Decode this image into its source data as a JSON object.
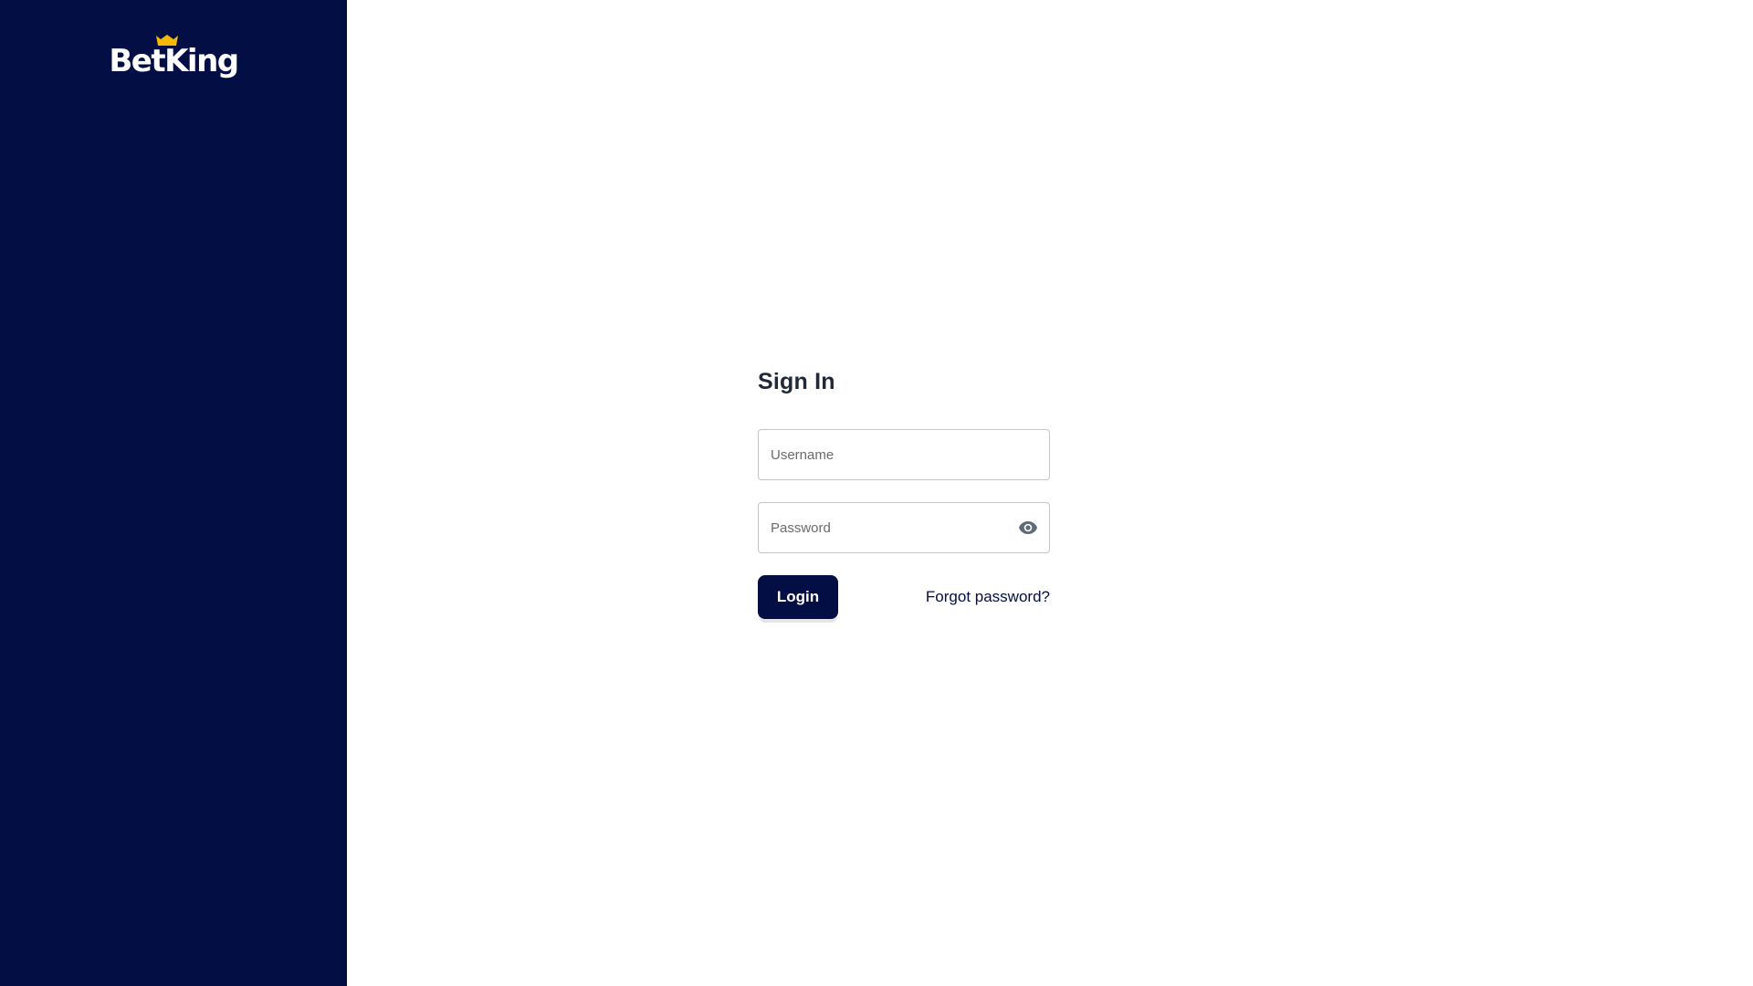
{
  "brand": {
    "name": "BetKing",
    "logo_icon": "crown-icon",
    "colors": {
      "sidebar": "#020e44",
      "crown": "#f6b800",
      "text": "#ffffff"
    }
  },
  "signin": {
    "title": "Sign In",
    "username": {
      "placeholder": "Username",
      "value": ""
    },
    "password": {
      "placeholder": "Password",
      "value": "",
      "toggle_icon": "eye-icon"
    },
    "login_label": "Login",
    "forgot_label": "Forgot password?",
    "colors": {
      "primary": "#020e44",
      "title": "#1f2937",
      "border": "#c4c4c4"
    }
  }
}
